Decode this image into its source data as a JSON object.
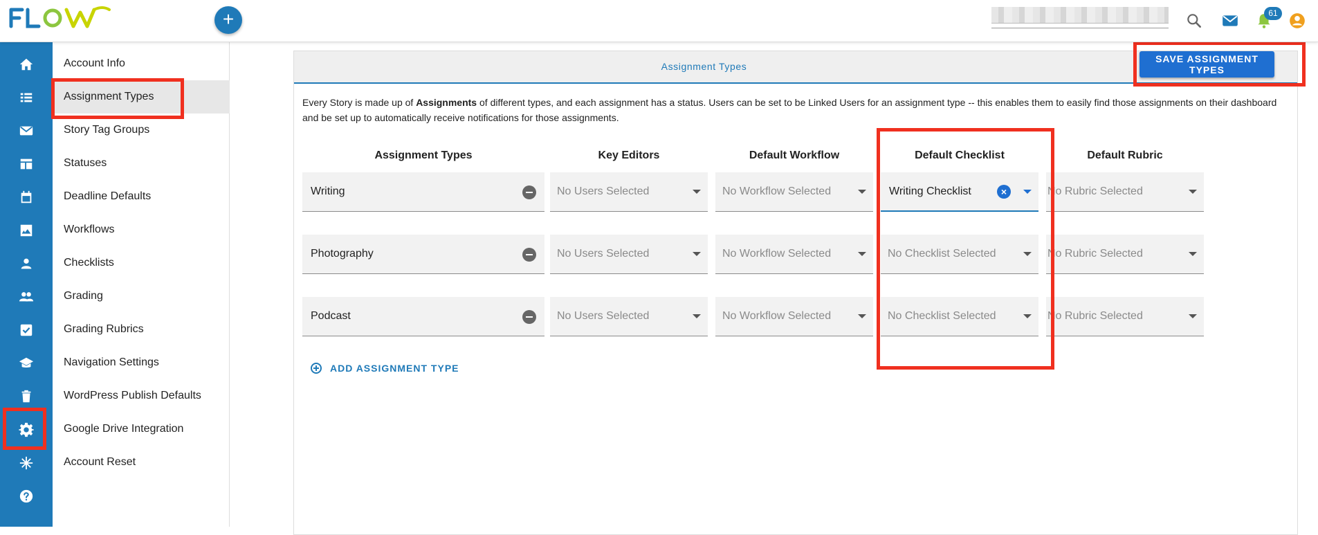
{
  "app": {
    "logo_text": "FLOW",
    "notification_count": "61"
  },
  "colors": {
    "brand": "#1f7ab8",
    "button": "#1f6fd1",
    "highlight": "#f0301f"
  },
  "rail": {
    "items": [
      {
        "icon": "home-icon"
      },
      {
        "icon": "list-icon"
      },
      {
        "icon": "mail-icon"
      },
      {
        "icon": "dashboard-icon"
      },
      {
        "icon": "calendar-icon"
      },
      {
        "icon": "image-icon"
      },
      {
        "icon": "person-icon"
      },
      {
        "icon": "people-icon"
      },
      {
        "icon": "checkbox-icon"
      },
      {
        "icon": "school-icon"
      },
      {
        "icon": "trash-icon"
      },
      {
        "icon": "settings-icon"
      },
      {
        "icon": "snowflake-icon"
      },
      {
        "icon": "help-icon"
      }
    ]
  },
  "subnav": {
    "items": [
      {
        "label": "Account Info"
      },
      {
        "label": "Assignment Types"
      },
      {
        "label": "Story Tag Groups"
      },
      {
        "label": "Statuses"
      },
      {
        "label": "Deadline Defaults"
      },
      {
        "label": "Workflows"
      },
      {
        "label": "Checklists"
      },
      {
        "label": "Grading"
      },
      {
        "label": "Grading Rubrics"
      },
      {
        "label": "Navigation Settings"
      },
      {
        "label": "WordPress Publish Defaults"
      },
      {
        "label": "Google Drive Integration"
      },
      {
        "label": "Account Reset"
      }
    ],
    "active": "Assignment Types"
  },
  "main": {
    "title": "Assignment Types",
    "save_label": "SAVE ASSIGNMENT TYPES",
    "description_a": "Every Story is made up of ",
    "description_bold": "Assignments",
    "description_b": " of different types, and each assignment has a status. Users can be set to be Linked Users for an assignment type -- this enables them to easily find those assignments on their dashboard and be set up to automatically receive notifications for those assignments.",
    "columns": {
      "types": "Assignment Types",
      "editors": "Key Editors",
      "workflow": "Default Workflow",
      "checklist": "Default Checklist",
      "rubric": "Default Rubric"
    },
    "rows": [
      {
        "type": "Writing",
        "editors": "No Users Selected",
        "workflow": "No Workflow Selected",
        "checklist": "Writing Checklist",
        "rubric": "No Rubric Selected"
      },
      {
        "type": "Photography",
        "editors": "No Users Selected",
        "workflow": "No Workflow Selected",
        "checklist": "No Checklist Selected",
        "rubric": "No Rubric Selected"
      },
      {
        "type": "Podcast",
        "editors": "No Users Selected",
        "workflow": "No Workflow Selected",
        "checklist": "No Checklist Selected",
        "rubric": "No Rubric Selected"
      }
    ],
    "add_label": "ADD ASSIGNMENT TYPE"
  }
}
